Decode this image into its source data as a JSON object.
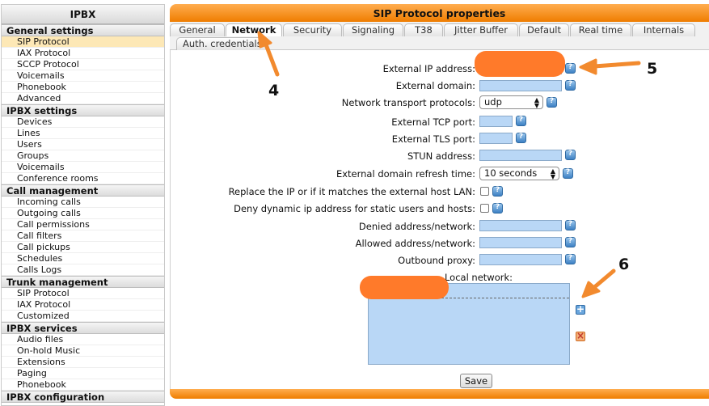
{
  "sidebar": {
    "title": "IPBX",
    "sections": [
      {
        "name": "General settings",
        "items": [
          "SIP Protocol",
          "IAX Protocol",
          "SCCP Protocol",
          "Voicemails",
          "Phonebook",
          "Advanced"
        ]
      },
      {
        "name": "IPBX settings",
        "items": [
          "Devices",
          "Lines",
          "Users",
          "Groups",
          "Voicemails",
          "Conference rooms"
        ]
      },
      {
        "name": "Call management",
        "items": [
          "Incoming calls",
          "Outgoing calls",
          "Call permissions",
          "Call filters",
          "Call pickups",
          "Schedules",
          "Calls Logs"
        ]
      },
      {
        "name": "Trunk management",
        "items": [
          "SIP Protocol",
          "IAX Protocol",
          "Customized"
        ]
      },
      {
        "name": "IPBX services",
        "items": [
          "Audio files",
          "On-hold Music",
          "Extensions",
          "Paging",
          "Phonebook"
        ]
      },
      {
        "name": "IPBX configuration",
        "items": []
      }
    ]
  },
  "panel": {
    "title": "SIP Protocol properties",
    "tabs": [
      "General",
      "Network",
      "Security",
      "Signaling",
      "T38",
      "Jitter Buffer",
      "Default",
      "Real time",
      "Internals"
    ],
    "active_tab": "Network",
    "subtab": "Auth. credentials"
  },
  "form": {
    "external_ip_label": "External IP address:",
    "external_domain_label": "External domain:",
    "transport_label": "Network transport protocols:",
    "transport_value": "udp",
    "tcp_port_label": "External TCP port:",
    "tls_port_label": "External TLS port:",
    "stun_label": "STUN address:",
    "refresh_label": "External domain refresh time:",
    "refresh_value": "10 seconds",
    "replace_ip_label": "Replace the IP or if it matches the external host LAN:",
    "deny_dynamic_label": "Deny dynamic ip address for static users and hosts:",
    "denied_label": "Denied address/network:",
    "allowed_label": "Allowed address/network:",
    "outbound_proxy_label": "Outbound proxy:",
    "local_network_label": "Local network:",
    "save_label": "Save"
  },
  "annotations": {
    "step4": "4",
    "step5": "5",
    "step6": "6",
    "color": "#f28a2e"
  },
  "colors": {
    "accent": "#ef7d00",
    "input_bg": "#b9d7f6",
    "active_nav": "#fde8b6"
  }
}
